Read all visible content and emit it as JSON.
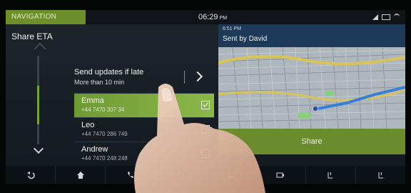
{
  "status": {
    "nav_tab": "NAVIGATION",
    "time": "06:29",
    "ampm": "PM"
  },
  "left_panel": {
    "title": "Share ETA",
    "updates": {
      "title": "Send updates if late",
      "subtitle": "More than 10 min"
    },
    "contacts": [
      {
        "name": "Emma",
        "number": "+44 7470 307 34",
        "checked": true
      },
      {
        "name": "Leo",
        "number": "+44 7470 286 749",
        "checked": false
      },
      {
        "name": "Andrew",
        "number": "+44 7470 248 248",
        "checked": false
      }
    ]
  },
  "message": {
    "time": "6:51 PM",
    "sender": "Sent by David"
  },
  "share_button": "Share",
  "bottom_bar": [
    {
      "icon": "back-icon"
    },
    {
      "icon": "home-icon"
    },
    {
      "icon": "phone-icon"
    },
    {
      "icon": "media-icon"
    },
    {
      "icon": "seat-icon"
    },
    {
      "icon": "camera-icon"
    },
    {
      "icon": "seat-heat-front-icon"
    },
    {
      "icon": "seat-heat-rear-icon"
    }
  ],
  "colors": {
    "accent_green": "#6c8f2c",
    "selected_row": "#7aa83e",
    "message_blue": "#1e3a58"
  }
}
